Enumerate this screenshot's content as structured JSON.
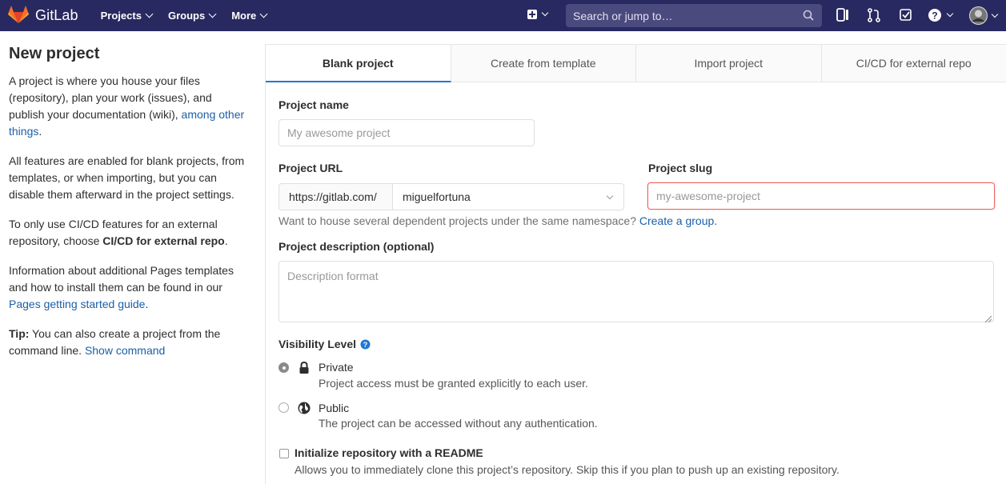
{
  "navbar": {
    "brand": "GitLab",
    "menu": [
      {
        "label": "Projects"
      },
      {
        "label": "Groups"
      },
      {
        "label": "More"
      }
    ],
    "search_placeholder": "Search or jump to…"
  },
  "intro": {
    "title": "New project",
    "p1_text": "A project is where you house your files (repository), plan your work (issues), and publish your documentation (wiki), ",
    "p1_link": "among other things",
    "p1_end": ".",
    "p2": "All features are enabled for blank projects, from templates, or when importing, but you can disable them afterward in the project settings.",
    "p3_text": "To only use CI/CD features for an external repository, choose ",
    "p3_bold": "CI/CD for external repo",
    "p3_end": ".",
    "p4_text": "Information about additional Pages templates and how to install them can be found in our ",
    "p4_link": "Pages getting started guide",
    "p4_end": ".",
    "tip_label": "Tip:",
    "tip_text": " You can also create a project from the command line. ",
    "tip_link": "Show command"
  },
  "tabs": [
    {
      "label": "Blank project",
      "active": true
    },
    {
      "label": "Create from template"
    },
    {
      "label": "Import project"
    },
    {
      "label": "CI/CD for external repo"
    }
  ],
  "form": {
    "project_name_label": "Project name",
    "project_name_placeholder": "My awesome project",
    "project_url_label": "Project URL",
    "url_prefix": "https://gitlab.com/",
    "namespace": "miguelfortuna",
    "project_slug_label": "Project slug",
    "project_slug_placeholder": "my-awesome-project",
    "group_help_text": "Want to house several dependent projects under the same namespace? ",
    "group_help_link": "Create a group.",
    "description_label": "Project description (optional)",
    "description_placeholder": "Description format",
    "visibility_label": "Visibility Level",
    "private_title": "Private",
    "private_desc": "Project access must be granted explicitly to each user.",
    "public_title": "Public",
    "public_desc": "The project can be accessed without any authentication.",
    "readme_title": "Initialize repository with a README",
    "readme_desc": "Allows you to immediately clone this project’s repository. Skip this if you plan to push up an existing repository."
  },
  "colors": {
    "navbar": "#292961",
    "link": "#1b5fa8",
    "active_tab_underline": "#1f78d1",
    "error_border": "#e66666"
  }
}
